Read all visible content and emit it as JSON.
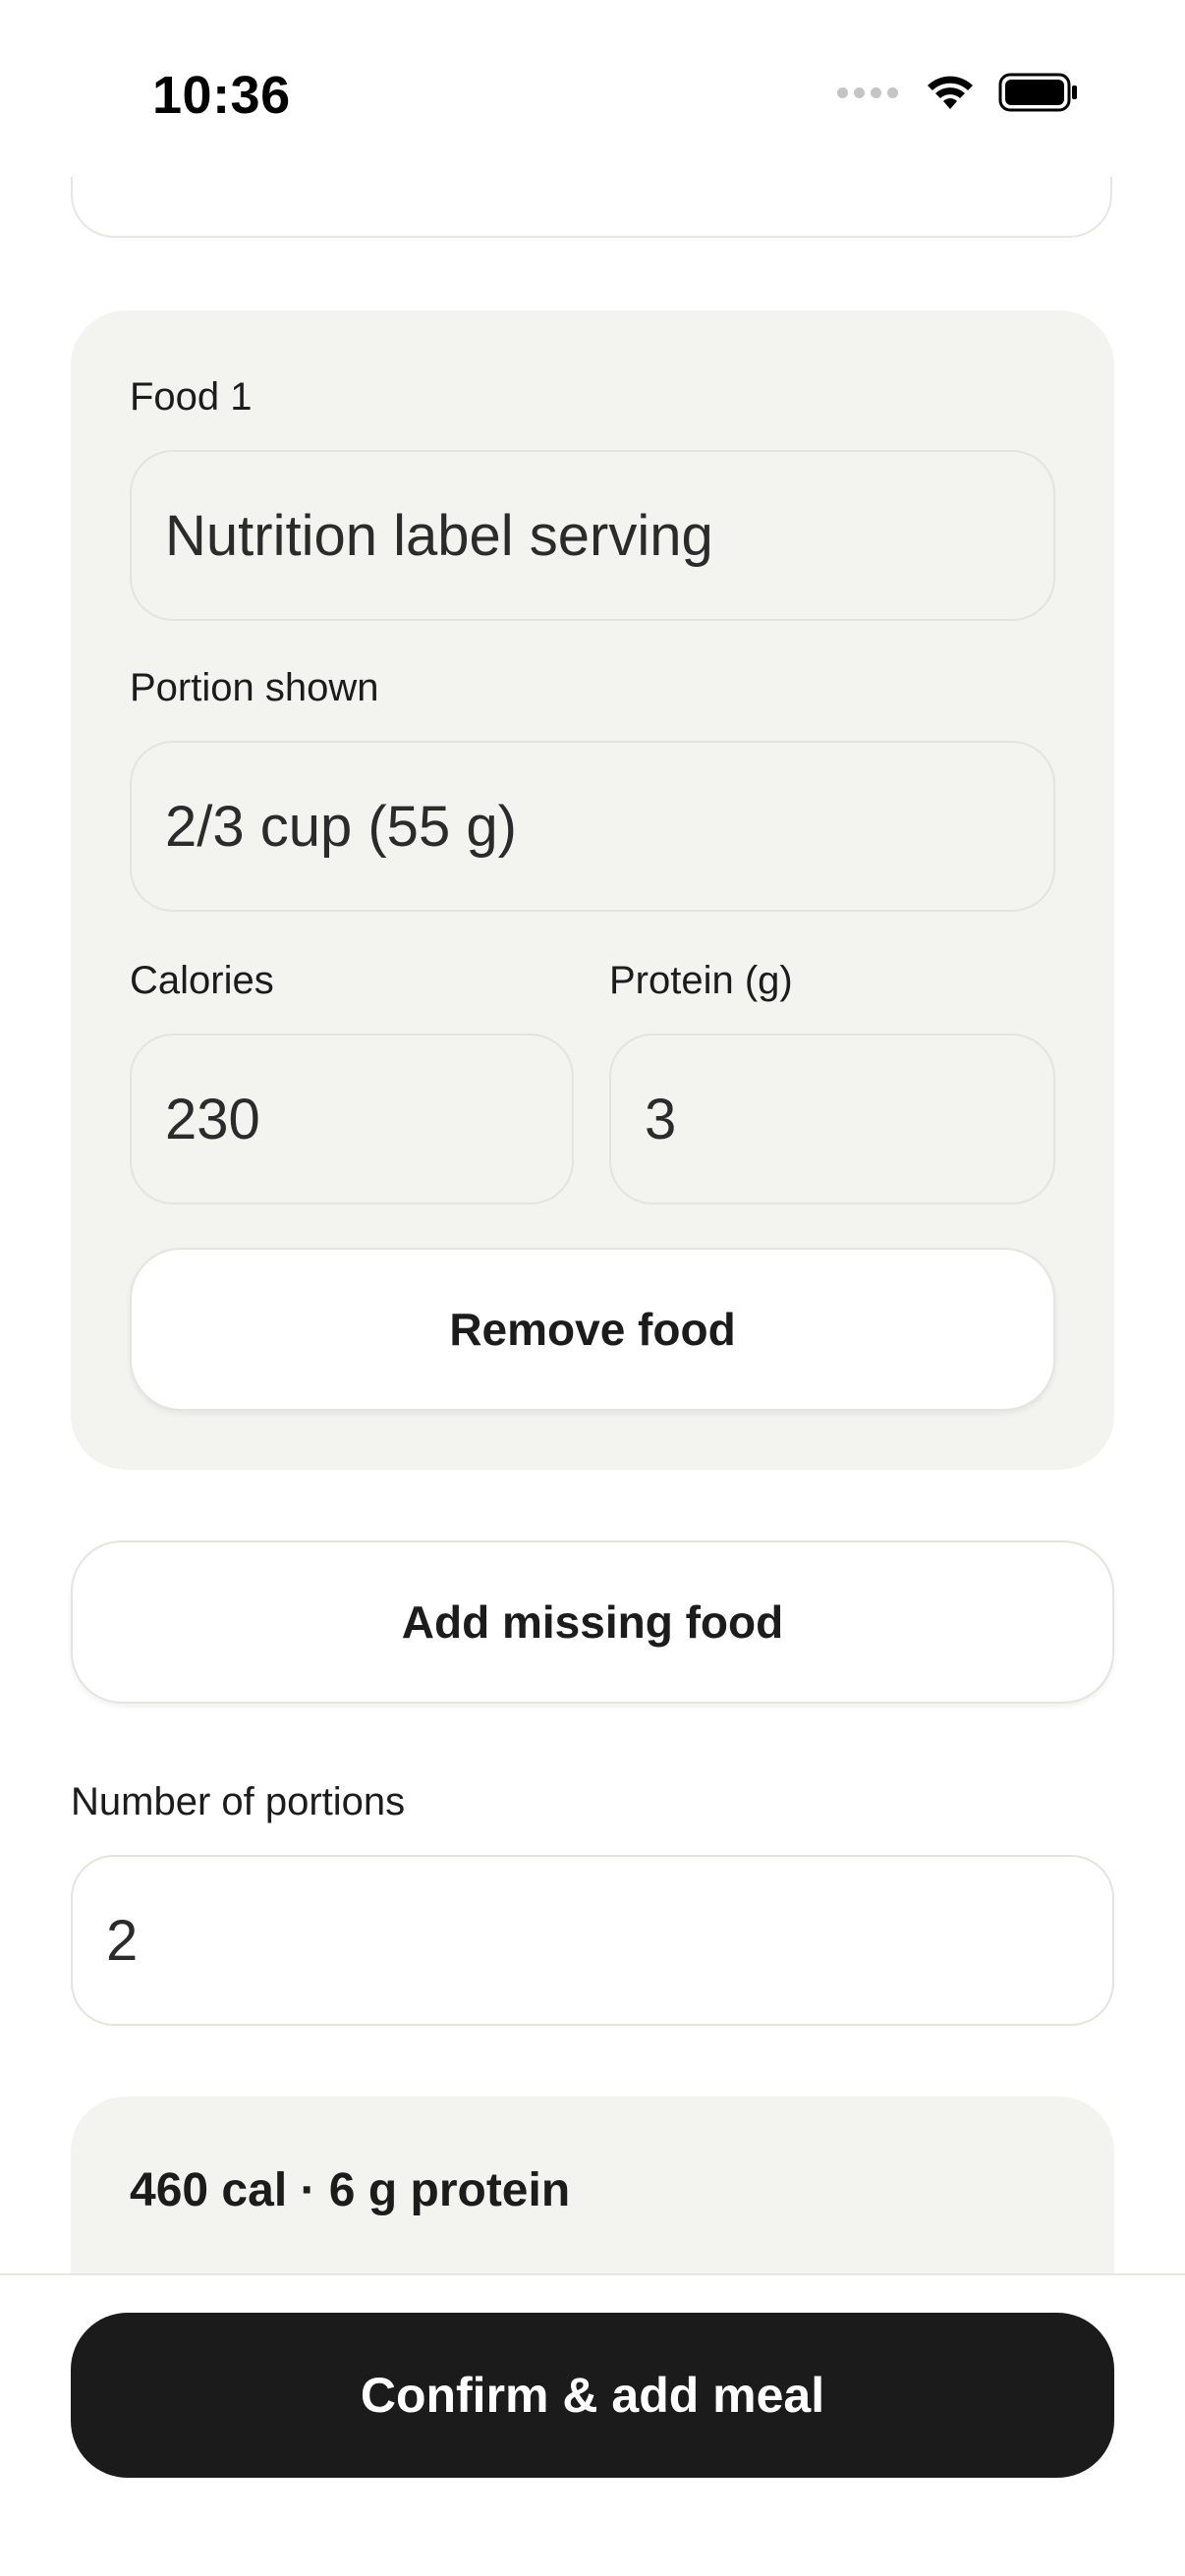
{
  "status_bar": {
    "time": "10:36",
    "icons": [
      "cellular-signal-icon",
      "wifi-icon",
      "battery-icon"
    ]
  },
  "food_card": {
    "title": "Food 1",
    "name_value": "Nutrition label serving",
    "portion_label": "Portion shown",
    "portion_value": "2/3 cup (55 g)",
    "calories_label": "Calories",
    "calories_value": "230",
    "protein_label": "Protein (g)",
    "protein_value": "3",
    "remove_label": "Remove food"
  },
  "add_missing_label": "Add missing food",
  "portions": {
    "label": "Number of portions",
    "value": "2"
  },
  "summary": {
    "text": "460 cal · 6 g protein"
  },
  "confirm_label": "Confirm & add meal",
  "colors": {
    "card_bg": "#f3f3f0",
    "primary_button": "#1b1b1b",
    "border": "#e3e3df"
  }
}
